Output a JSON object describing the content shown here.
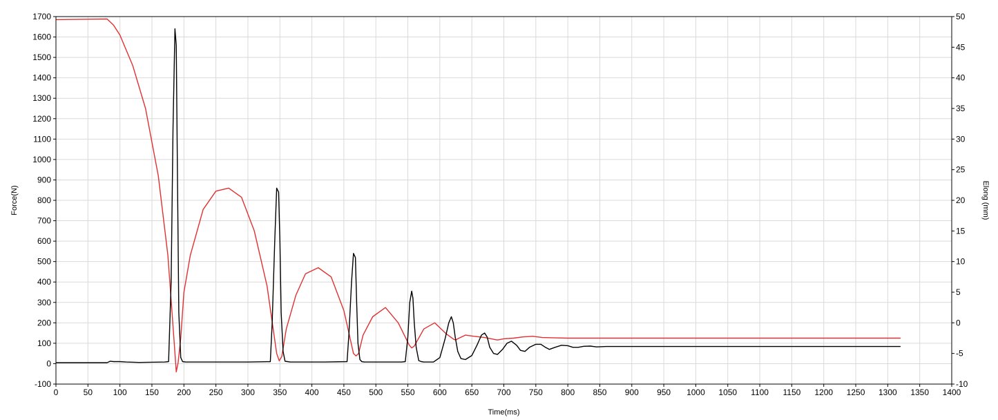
{
  "chart_data": {
    "type": "line",
    "title": "",
    "xlabel": "Time(ms)",
    "ylabel": "Force(N)",
    "y2label": "Elong (mm)",
    "xlim": [
      0,
      1400
    ],
    "ylim": [
      -100,
      1700
    ],
    "y2lim": [
      -10,
      50
    ],
    "x_ticks": [
      0,
      50,
      100,
      150,
      200,
      250,
      300,
      350,
      400,
      450,
      500,
      550,
      600,
      650,
      700,
      750,
      800,
      850,
      900,
      950,
      1000,
      1050,
      1100,
      1150,
      1200,
      1250,
      1300,
      1350,
      1400
    ],
    "y_ticks": [
      -100,
      0,
      100,
      200,
      300,
      400,
      500,
      600,
      700,
      800,
      900,
      1000,
      1100,
      1200,
      1300,
      1400,
      1500,
      1600,
      1700
    ],
    "y2_ticks": [
      -10,
      -5,
      0,
      5,
      10,
      15,
      20,
      25,
      30,
      35,
      40,
      45,
      50
    ],
    "grid": true,
    "legend": "none",
    "colors": {
      "force": "#000000",
      "elong": "#e03030",
      "grid": "#d9d9d9",
      "axis": "#000000"
    },
    "series": [
      {
        "axis": "left",
        "x": [
          0,
          80,
          85,
          90,
          100,
          110,
          130,
          170,
          176,
          180,
          183,
          186,
          188,
          190,
          192,
          195,
          198,
          203,
          210,
          250,
          300,
          335,
          338,
          342,
          345,
          348,
          350,
          352,
          355,
          358,
          362,
          366,
          370,
          420,
          455,
          458,
          462,
          465,
          468,
          470,
          472,
          475,
          478,
          482,
          486,
          490,
          540,
          546,
          550,
          553,
          556,
          558,
          560,
          563,
          567,
          571,
          575,
          580,
          590,
          600,
          608,
          614,
          618,
          621,
          624,
          628,
          633,
          640,
          650,
          658,
          665,
          670,
          674,
          678,
          684,
          690,
          698,
          705,
          712,
          720,
          726,
          733,
          740,
          750,
          758,
          765,
          771,
          780,
          790,
          800,
          808,
          816,
          825,
          835,
          845,
          860,
          880,
          900,
          1000,
          1100,
          1200,
          1320
        ],
        "y": [
          5,
          5,
          12,
          10,
          10,
          8,
          6,
          8,
          10,
          400,
          1150,
          1640,
          1560,
          900,
          250,
          30,
          10,
          8,
          8,
          8,
          8,
          10,
          200,
          600,
          860,
          840,
          600,
          250,
          60,
          12,
          10,
          8,
          8,
          8,
          10,
          150,
          400,
          540,
          520,
          300,
          100,
          20,
          10,
          8,
          8,
          8,
          8,
          10,
          130,
          300,
          355,
          320,
          200,
          80,
          15,
          10,
          8,
          8,
          8,
          30,
          120,
          200,
          230,
          200,
          130,
          60,
          25,
          20,
          40,
          90,
          140,
          150,
          130,
          80,
          50,
          45,
          70,
          100,
          110,
          90,
          65,
          60,
          80,
          95,
          95,
          80,
          70,
          80,
          90,
          88,
          80,
          80,
          85,
          86,
          82,
          84,
          84,
          84,
          84,
          84,
          84,
          84
        ]
      },
      {
        "axis": "right",
        "x": [
          0,
          80,
          90,
          100,
          120,
          140,
          160,
          175,
          185,
          188,
          191,
          195,
          200,
          210,
          230,
          250,
          270,
          290,
          310,
          330,
          345,
          349,
          353,
          360,
          375,
          390,
          410,
          430,
          450,
          465,
          469,
          473,
          480,
          495,
          515,
          535,
          552,
          556,
          560,
          575,
          592,
          610,
          622,
          625,
          628,
          640,
          653,
          670,
          685,
          690,
          700,
          715,
          730,
          745,
          760,
          780,
          800,
          850,
          900,
          1000,
          1100,
          1200,
          1320
        ],
        "y": [
          49.5,
          49.6,
          48.6,
          47,
          42,
          35,
          24,
          11,
          -3.5,
          -8,
          -6.5,
          -2.5,
          5,
          11,
          18.5,
          21.5,
          22,
          20.5,
          15,
          6,
          -5,
          -6.2,
          -5.5,
          -1,
          4.5,
          8,
          9,
          7.5,
          2,
          -5,
          -5.4,
          -5,
          -2,
          1,
          2.5,
          0,
          -3.6,
          -4.1,
          -3.8,
          -1,
          0,
          -1.8,
          -2.7,
          -2.8,
          -2.6,
          -2,
          -2.2,
          -2.4,
          -2.7,
          -2.8,
          -2.6,
          -2.5,
          -2.3,
          -2.2,
          -2.4,
          -2.45,
          -2.5,
          -2.5,
          -2.5,
          -2.5,
          -2.5,
          -2.5,
          -2.5
        ]
      }
    ]
  }
}
